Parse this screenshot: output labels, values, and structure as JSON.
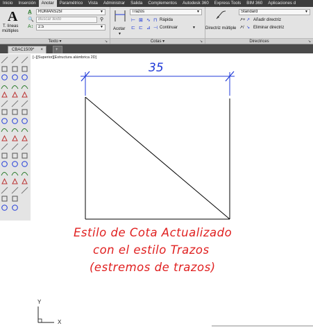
{
  "menu": {
    "tabs": [
      "Inicio",
      "Inserción",
      "Anotar",
      "Paramétrico",
      "Vista",
      "Administrar",
      "Salida",
      "Complementos",
      "Autodesk 360",
      "Express Tools",
      "BIM 360",
      "Aplicaciones d"
    ],
    "active": "Anotar"
  },
  "ribbon": {
    "texto": {
      "big_label_1": "T. líneas",
      "big_label_2": "múltiples",
      "font": "ROMANS25I",
      "search_placeholder": "Buscar texto",
      "size": "2.5",
      "title": "Texto"
    },
    "cotas": {
      "acotar_label": "Acotar",
      "style": "Trazos",
      "rapida": "Rápida",
      "continuar": "Continuar",
      "title": "Cotas"
    },
    "directrices": {
      "multiple_label": "Directriz múltiple",
      "style": "Standard",
      "add": "Añadir directriz",
      "remove": "Eliminar directriz",
      "title": "Directrices"
    }
  },
  "file_tabs": {
    "active": "CBAC1509*",
    "close": "×",
    "plus": "+"
  },
  "viewport": {
    "label": "[−][Superior][Estructura alámbrica 2D]"
  },
  "drawing": {
    "dimension_value": "35",
    "note_line_1": "Estilo de Cota Actualizado",
    "note_line_2": "con el estilo Trazos",
    "note_line_3": "(estremos de trazos)",
    "ucs_y": "Y",
    "ucs_x": "X"
  },
  "colors": {
    "dimension": "#1f3ad8",
    "note": "#e02020",
    "geometry": "#000000"
  }
}
